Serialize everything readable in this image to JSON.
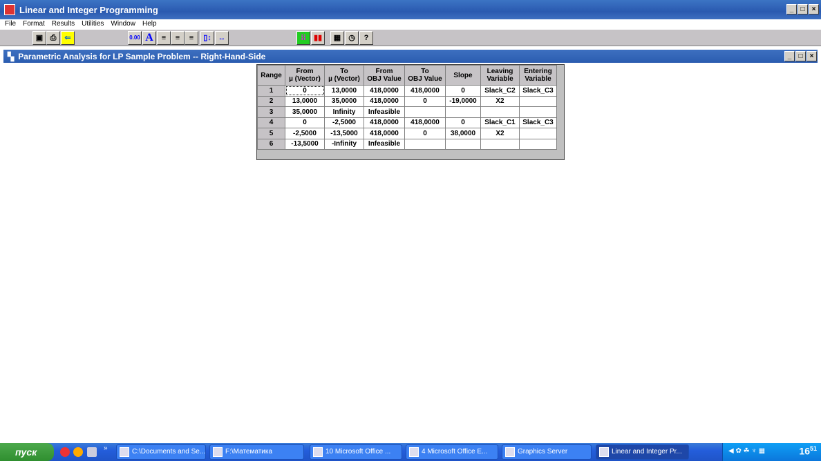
{
  "app": {
    "title": "Linear and Integer Programming",
    "icon_label": "WinQSB"
  },
  "menu": [
    "File",
    "Format",
    "Results",
    "Utilities",
    "Window",
    "Help"
  ],
  "toolbar": {
    "number_format": "0.00",
    "font": "A"
  },
  "child": {
    "title": "Parametric Analysis for LP Sample Problem -- Right-Hand-Side"
  },
  "table": {
    "headers": [
      [
        "Range",
        ""
      ],
      [
        "From",
        "µ (Vector)"
      ],
      [
        "To",
        "µ (Vector)"
      ],
      [
        "From",
        "OBJ Value"
      ],
      [
        "To",
        "OBJ Value"
      ],
      [
        "Slope",
        ""
      ],
      [
        "Leaving",
        "Variable"
      ],
      [
        "Entering",
        "Variable"
      ]
    ],
    "rows": [
      [
        "1",
        "0",
        "13,0000",
        "418,0000",
        "418,0000",
        "0",
        "Slack_C2",
        "Slack_C3"
      ],
      [
        "2",
        "13,0000",
        "35,0000",
        "418,0000",
        "0",
        "-19,0000",
        "X2",
        ""
      ],
      [
        "3",
        "35,0000",
        "Infinity",
        "Infeasible",
        "",
        "",
        "",
        ""
      ],
      [
        "4",
        "0",
        "-2,5000",
        "418,0000",
        "418,0000",
        "0",
        "Slack_C1",
        "Slack_C3"
      ],
      [
        "5",
        "-2,5000",
        "-13,5000",
        "418,0000",
        "0",
        "38,0000",
        "X2",
        ""
      ],
      [
        "6",
        "-13,5000",
        "-Infinity",
        "Infeasible",
        "",
        "",
        "",
        ""
      ]
    ]
  },
  "taskbar": {
    "start": "пуск",
    "more": "»",
    "tasks": [
      "C:\\Documents and Se...",
      "F:\\Математика",
      "10 Microsoft Office ...",
      "4 Microsoft Office E...",
      "Graphics Server",
      "Linear and Integer Pr..."
    ],
    "clock_h": "16",
    "clock_m": "51"
  }
}
